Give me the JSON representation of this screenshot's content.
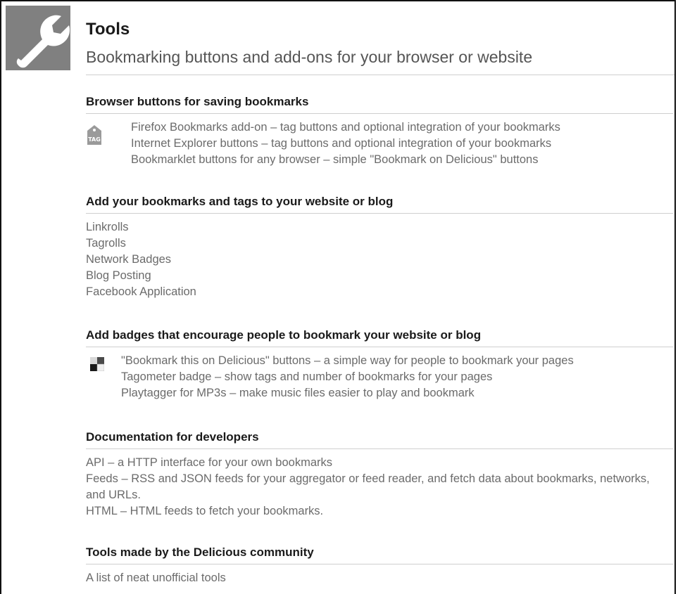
{
  "header": {
    "title": "Tools",
    "subtitle": "Bookmarking buttons and add-ons for your browser or website",
    "icon": "wrench-icon"
  },
  "sections": [
    {
      "heading": "Browser buttons for saving bookmarks",
      "icon": "tag-icon",
      "icon_label": "TAG",
      "items": [
        "Firefox Bookmarks add-on – tag buttons and optional integration of your bookmarks",
        "Internet Explorer buttons – tag buttons and optional integration of your bookmarks",
        "Bookmarklet buttons for any browser – simple \"Bookmark on Delicious\" buttons"
      ]
    },
    {
      "heading": "Add your bookmarks and tags to your website or blog",
      "items": [
        "Linkrolls",
        "Tagrolls",
        "Network Badges",
        "Blog Posting",
        "Facebook Application"
      ]
    },
    {
      "heading": "Add badges that encourage people to bookmark your website or blog",
      "icon": "delicious-logo-icon",
      "items": [
        "\"Bookmark this on Delicious\" buttons – a simple way for people to bookmark your pages",
        "Tagometer badge – show tags and number of bookmarks for your pages",
        "Playtagger for MP3s – make music files easier to play and bookmark"
      ]
    },
    {
      "heading": "Documentation for developers",
      "items": [
        "API – a HTTP interface for your own bookmarks",
        "Feeds – RSS and JSON feeds for your aggregator or feed reader, and fetch data about bookmarks, networks, and URLs.",
        "HTML – HTML feeds to fetch your bookmarks."
      ]
    },
    {
      "heading": "Tools made by the Delicious community",
      "items": [
        "A list of neat unofficial tools"
      ]
    }
  ]
}
